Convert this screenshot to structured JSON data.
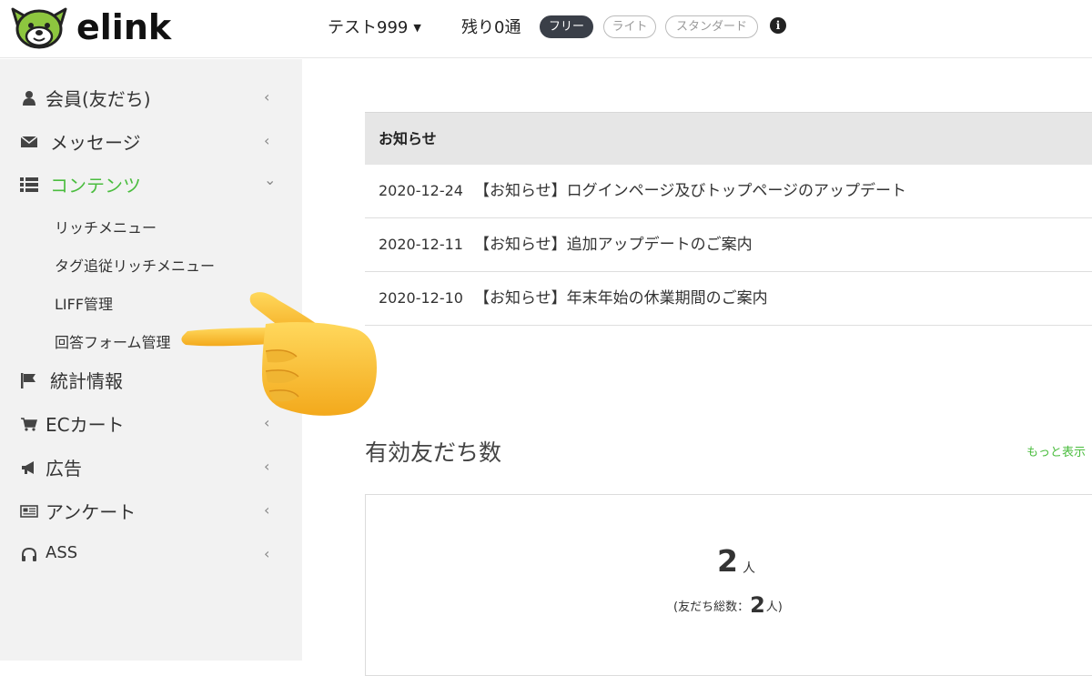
{
  "header": {
    "logo_text": "elink",
    "user_menu": "テスト999",
    "remaining": "残り0通",
    "plans": [
      "フリー",
      "ライト",
      "スタンダード"
    ],
    "info_icon": "info-icon"
  },
  "sidebar": {
    "items": [
      {
        "label": "会員(友だち)",
        "icon": "user-icon",
        "chevron": "‹"
      },
      {
        "label": "メッセージ",
        "icon": "envelope-icon",
        "chevron": "‹"
      },
      {
        "label": "コンテンツ",
        "icon": "list-icon",
        "chevron": "⌄"
      },
      {
        "label": "統計情報",
        "icon": "flag-icon",
        "chevron": ""
      },
      {
        "label": "ECカート",
        "icon": "cart-icon",
        "chevron": "‹"
      },
      {
        "label": "広告",
        "icon": "bullhorn-icon",
        "chevron": "‹"
      },
      {
        "label": "アンケート",
        "icon": "newspaper-icon",
        "chevron": "‹"
      },
      {
        "label": "ASS",
        "icon": "headphones-icon",
        "chevron": "‹"
      }
    ],
    "sub_items": [
      "リッチメニュー",
      "タグ追従リッチメニュー",
      "LIFF管理",
      "回答フォーム管理"
    ]
  },
  "news": {
    "heading": "お知らせ",
    "rows": [
      {
        "date": "2020-12-24",
        "title": "【お知らせ】ログインページ及びトップページのアップデート"
      },
      {
        "date": "2020-12-11",
        "title": "【お知らせ】追加アップデートのご案内"
      },
      {
        "date": "2020-12-10",
        "title": "【お知らせ】年末年始の休業期間のご案内"
      }
    ]
  },
  "friends": {
    "title": "有効友だち数",
    "more": "もっと表示",
    "count": "2",
    "unit": "人",
    "total_prefix": "(友だち総数：",
    "total_count": "2",
    "total_suffix": "人)"
  },
  "colors": {
    "accent_green": "#4bbd3f",
    "sidebar_bg": "#f2f2f2",
    "pill_dark": "#3a3f48"
  }
}
